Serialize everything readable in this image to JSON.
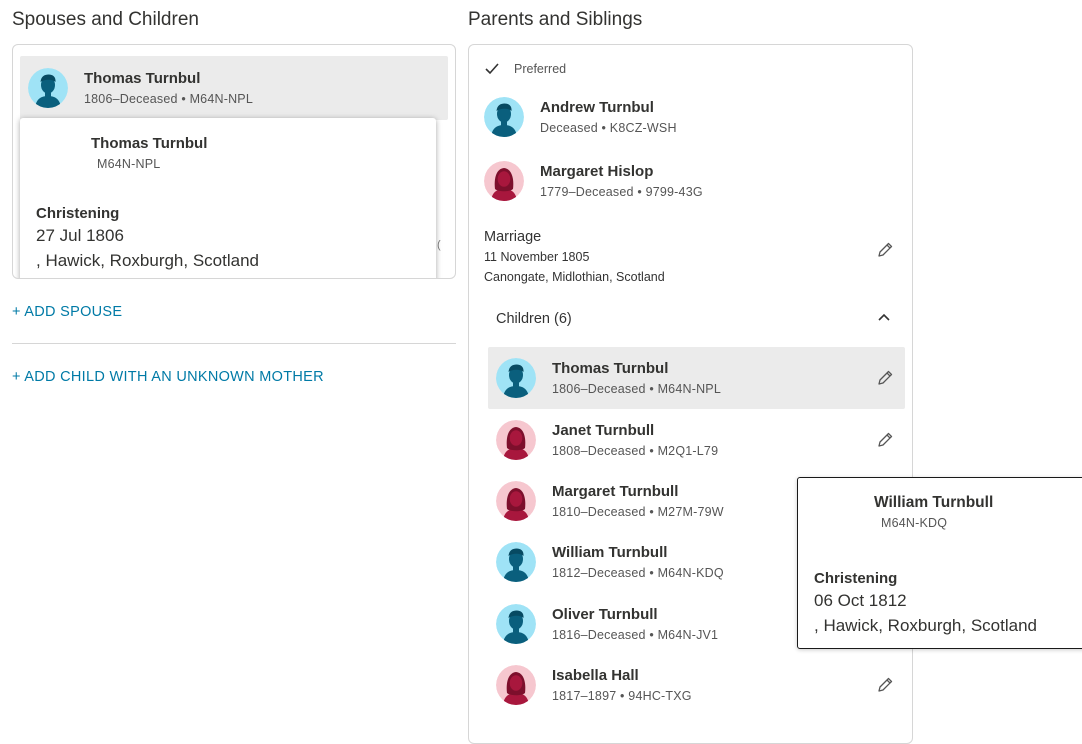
{
  "left": {
    "title": "Spouses and Children",
    "selected_person": {
      "name": "Thomas Turnbul",
      "meta": "1806–Deceased •  M64N-NPL"
    },
    "popup": {
      "name": "Thomas Turnbul",
      "id": "M64N-NPL",
      "event": "Christening",
      "date": "27 Jul 1806",
      "place": ", Hawick, Roxburgh, Scotland"
    },
    "add_spouse": "+  ADD SPOUSE",
    "add_child": "+  ADD CHILD WITH AN UNKNOWN MOTHER"
  },
  "right": {
    "title": "Parents and Siblings",
    "preferred_label": "Preferred",
    "father": {
      "name": "Andrew Turnbul",
      "meta": "Deceased •  K8CZ-WSH"
    },
    "mother": {
      "name": "Margaret Hislop",
      "meta": "1779–Deceased •  9799-43G"
    },
    "marriage": {
      "label": "Marriage",
      "date": "11 November 1805",
      "place": "Canongate, Midlothian, Scotland"
    },
    "children_label": "Children (6)",
    "children": [
      {
        "name": "Thomas Turnbul",
        "meta": "1806–Deceased •  M64N-NPL",
        "gender": "male"
      },
      {
        "name": "Janet Turnbull",
        "meta": "1808–Deceased •  M2Q1-L79",
        "gender": "female"
      },
      {
        "name": "Margaret Turnbull",
        "meta": "1810–Deceased •  M27M-79W",
        "gender": "female"
      },
      {
        "name": "William Turnbull",
        "meta": "1812–Deceased •  M64N-KDQ",
        "gender": "male"
      },
      {
        "name": "Oliver Turnbull",
        "meta": "1816–Deceased •  M64N-JV1",
        "gender": "male"
      },
      {
        "name": "Isabella Hall",
        "meta": "1817–1897 •  94HC-TXG",
        "gender": "female"
      }
    ]
  },
  "hover_popup": {
    "name": "William Turnbull",
    "id": "M64N-KDQ",
    "event": "Christening",
    "date": "06 Oct 1812",
    "place": ", Hawick, Roxburgh, Scotland"
  },
  "colors": {
    "male_bg": "#9fe3f6",
    "male_fg": "#0a5f7d",
    "female_bg": "#f6c7cf",
    "female_fg": "#a8173d",
    "link": "#007aa6",
    "highlight": "#ebebeb"
  }
}
